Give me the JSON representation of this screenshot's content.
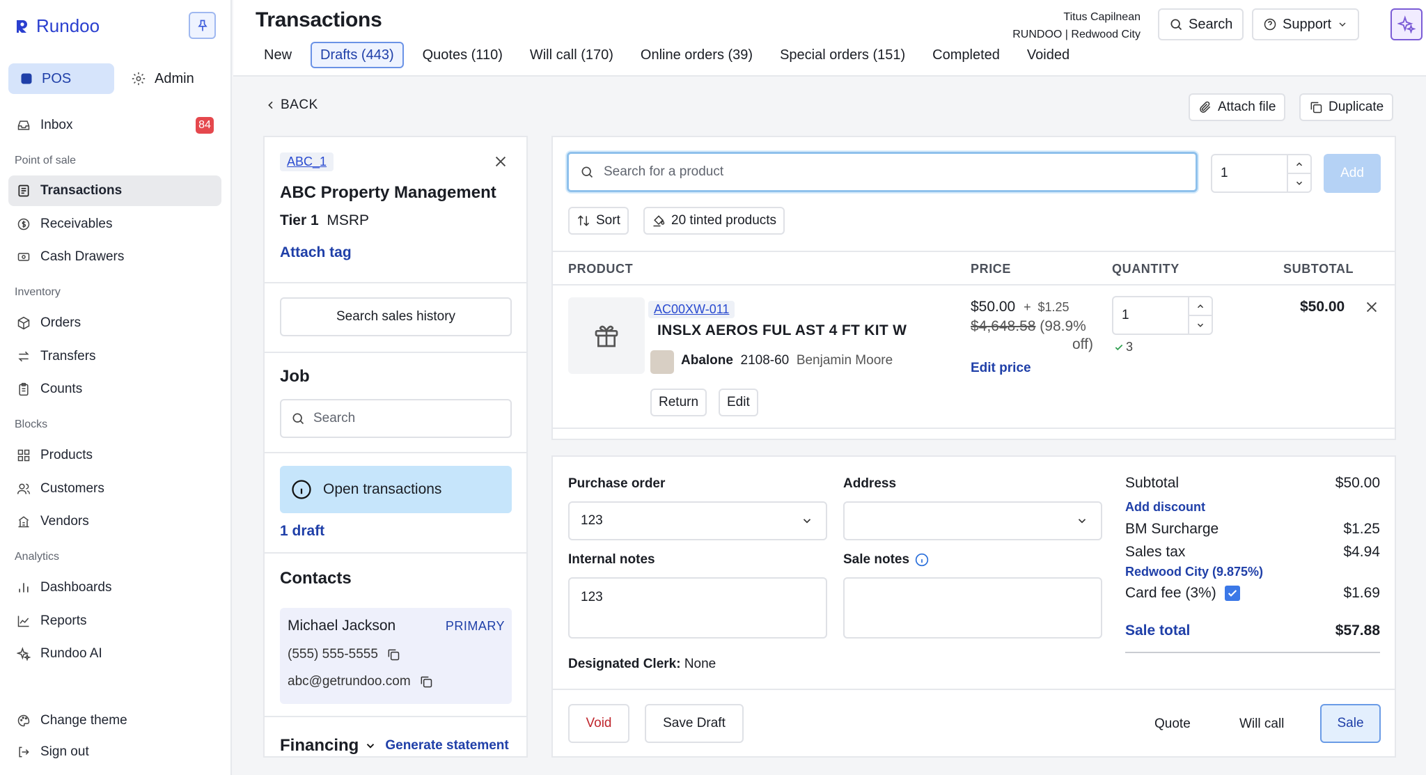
{
  "app": {
    "name": "Rundoo"
  },
  "sidebar": {
    "modes": [
      {
        "label": "POS"
      },
      {
        "label": "Admin"
      }
    ],
    "inbox": {
      "label": "Inbox",
      "count": "84"
    },
    "sections": [
      {
        "title": "Point of sale",
        "items": [
          {
            "label": "Transactions"
          },
          {
            "label": "Receivables"
          },
          {
            "label": "Cash Drawers"
          }
        ]
      },
      {
        "title": "Inventory",
        "items": [
          {
            "label": "Orders"
          },
          {
            "label": "Transfers"
          },
          {
            "label": "Counts"
          }
        ]
      },
      {
        "title": "Blocks",
        "items": [
          {
            "label": "Products"
          },
          {
            "label": "Customers"
          },
          {
            "label": "Vendors"
          }
        ]
      },
      {
        "title": "Analytics",
        "items": [
          {
            "label": "Dashboards"
          },
          {
            "label": "Reports"
          },
          {
            "label": "Rundoo AI"
          }
        ]
      }
    ],
    "bottom": [
      {
        "label": "Change theme"
      },
      {
        "label": "Sign out"
      }
    ]
  },
  "header": {
    "title": "Transactions",
    "tabs": [
      {
        "label": "New"
      },
      {
        "label": "Drafts (443)"
      },
      {
        "label": "Quotes (110)"
      },
      {
        "label": "Will call (170)"
      },
      {
        "label": "Online orders (39)"
      },
      {
        "label": "Special orders (151)"
      },
      {
        "label": "Completed"
      },
      {
        "label": "Voided"
      }
    ],
    "active_tab": "Drafts (443)",
    "user_name": "Titus Capilnean",
    "user_org": "RUNDOO | Redwood City",
    "search_label": "Search",
    "support_label": "Support"
  },
  "toolbar": {
    "back_label": "BACK",
    "attach_file_label": "Attach file",
    "duplicate_label": "Duplicate"
  },
  "customer": {
    "tag": "ABC_1",
    "name": "ABC Property Management",
    "tier": "Tier 1",
    "pricing": "MSRP",
    "attach_tag_label": "Attach tag",
    "search_history_label": "Search sales history",
    "job": {
      "title": "Job",
      "placeholder": "Search"
    },
    "open_transactions": {
      "label": "Open transactions",
      "link": "1 draft"
    },
    "contacts": {
      "title": "Contacts",
      "name": "Michael Jackson",
      "badge": "PRIMARY",
      "phone": "(555) 555-5555",
      "email": "abc@getrundoo.com"
    },
    "financing": {
      "title": "Financing",
      "link": "Generate statement"
    }
  },
  "product_search": {
    "placeholder": "Search for a product",
    "quantity": "1",
    "add_label": "Add",
    "sort_label": "Sort",
    "tinted_label": "20 tinted products"
  },
  "line_items": {
    "columns": [
      "PRODUCT",
      "PRICE",
      "QUANTITY",
      "SUBTOTAL"
    ],
    "rows": [
      {
        "sku": "AC00XW-011",
        "name": "INSLX AEROS FUL AST 4 FT KIT W",
        "color_name": "Abalone",
        "color_code": "2108-60",
        "brand": "Benjamin Moore",
        "swatch": "#d8cfc4",
        "price": "$50.00",
        "surcharge_prefix": "+",
        "surcharge": "$1.25",
        "original_price": "$4,648.58",
        "discount_line1": "(98.9%",
        "discount_line2": "off)",
        "edit_price_label": "Edit price",
        "quantity": "1",
        "stock": "3",
        "subtotal": "$50.00",
        "return_label": "Return",
        "edit_label": "Edit"
      }
    ]
  },
  "order_form": {
    "purchase_order": {
      "label": "Purchase order",
      "value": "123"
    },
    "address": {
      "label": "Address",
      "value": ""
    },
    "internal_notes": {
      "label": "Internal notes",
      "value": "123"
    },
    "sale_notes": {
      "label": "Sale notes",
      "value": ""
    },
    "designated_clerk": {
      "label": "Designated Clerk:",
      "value": "None"
    }
  },
  "summary": {
    "subtotal_label": "Subtotal",
    "subtotal": "$50.00",
    "add_discount": "Add discount",
    "surcharge_label": "BM Surcharge",
    "surcharge": "$1.25",
    "tax_label": "Sales tax",
    "tax": "$4.94",
    "tax_region": "Redwood City (9.875%)",
    "card_fee_label": "Card fee (3%)",
    "card_fee": "$1.69",
    "card_fee_checked": true,
    "total_label": "Sale total",
    "total": "$57.88"
  },
  "actions": {
    "void": "Void",
    "save_draft": "Save Draft",
    "quote": "Quote",
    "will_call": "Will call",
    "sale": "Sale"
  },
  "colors": {
    "accent": "#1f3fa8",
    "badge": "#e5484d",
    "void_text": "#c0262d",
    "info_bg": "#c6e5fb"
  }
}
